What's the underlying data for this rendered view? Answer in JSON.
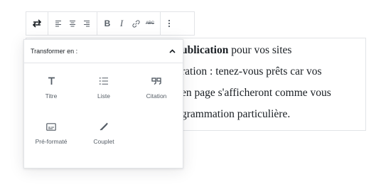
{
  "toolbar": {
    "items": [
      {
        "name": "block-switcher",
        "icon": "swap-arrows-icon"
      },
      {
        "name": "align-left",
        "icon": "align-left-icon"
      },
      {
        "name": "align-center",
        "icon": "align-center-icon"
      },
      {
        "name": "align-right",
        "icon": "align-right-icon"
      },
      {
        "name": "bold",
        "label": "B"
      },
      {
        "name": "italic",
        "label": "I"
      },
      {
        "name": "link",
        "icon": "link-icon"
      },
      {
        "name": "strikethrough",
        "label": "ABC"
      },
      {
        "name": "more-options",
        "icon": "more-vertical-icon"
      }
    ]
  },
  "popover": {
    "title": "Transformer en :",
    "toggle_icon": "chevron-up-icon",
    "blocks": [
      {
        "label": "Titre",
        "icon": "heading-icon"
      },
      {
        "label": "Liste",
        "icon": "list-icon"
      },
      {
        "label": "Citation",
        "icon": "quote-icon"
      },
      {
        "label": "Pré-formaté",
        "icon": "preformatted-icon"
      },
      {
        "label": "Couplet",
        "icon": "verse-icon"
      }
    ]
  },
  "paragraph": {
    "line1_bold": "ublication",
    "line1_rest": " pour vos sites",
    "line2": "ration : tenez-vous prêts car vos",
    "line3": "en page s'afficheront comme vous",
    "line4": "grammation particulière."
  }
}
